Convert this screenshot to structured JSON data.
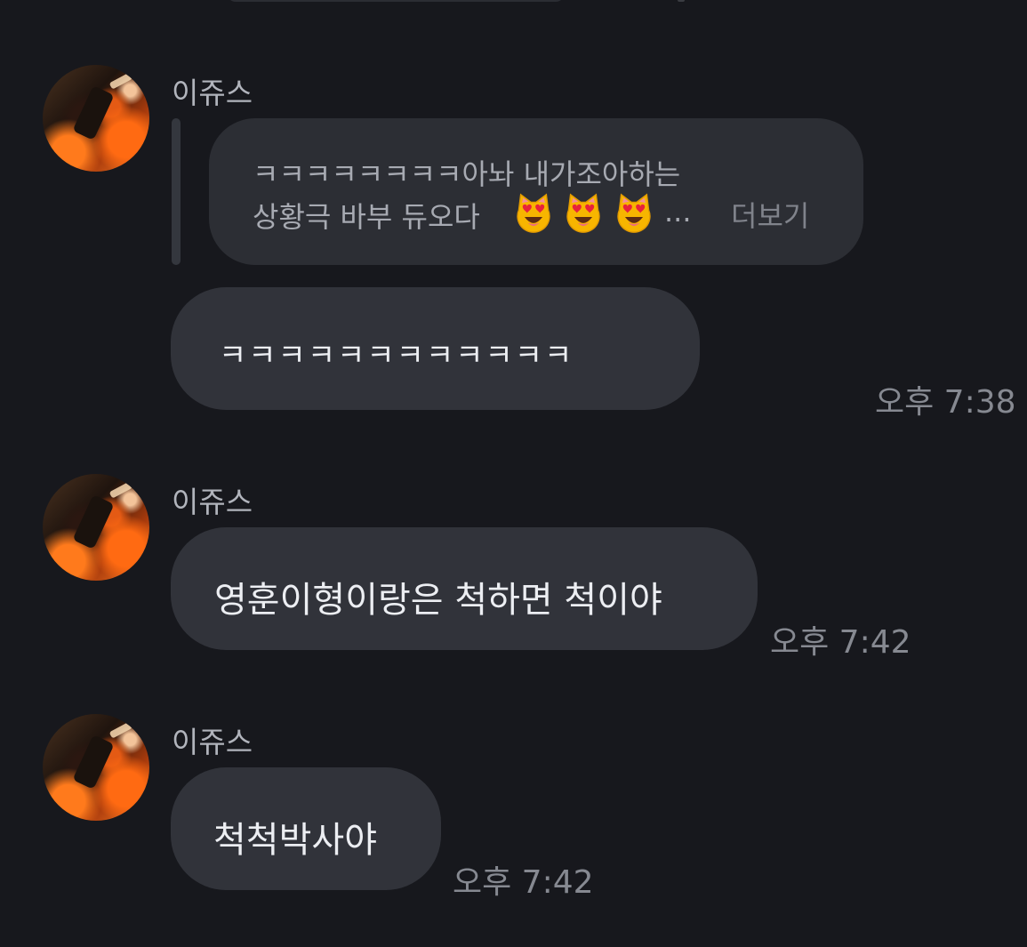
{
  "chat": {
    "messages": [
      {
        "sender": "이쥬스",
        "quoted_line1": "ㅋㅋㅋㅋㅋㅋㅋㅋ아놔 내가조아하는",
        "quoted_line2": "상황극 바부 듀오다",
        "quoted_emoji": "smiling-cat-heart-eyes-icon",
        "quoted_ellipsis": "...",
        "more_label": "더보기",
        "text": "ㅋㅋㅋㅋㅋㅋㅋㅋㅋㅋㅋㅋ",
        "time": "오후 7:38"
      },
      {
        "sender": "이쥬스",
        "text": "영훈이형이랑은 척하면 척이야",
        "time": "오후 7:42"
      },
      {
        "sender": "이쥬스",
        "text": "척척박사야",
        "time": "오후 7:42"
      }
    ]
  }
}
